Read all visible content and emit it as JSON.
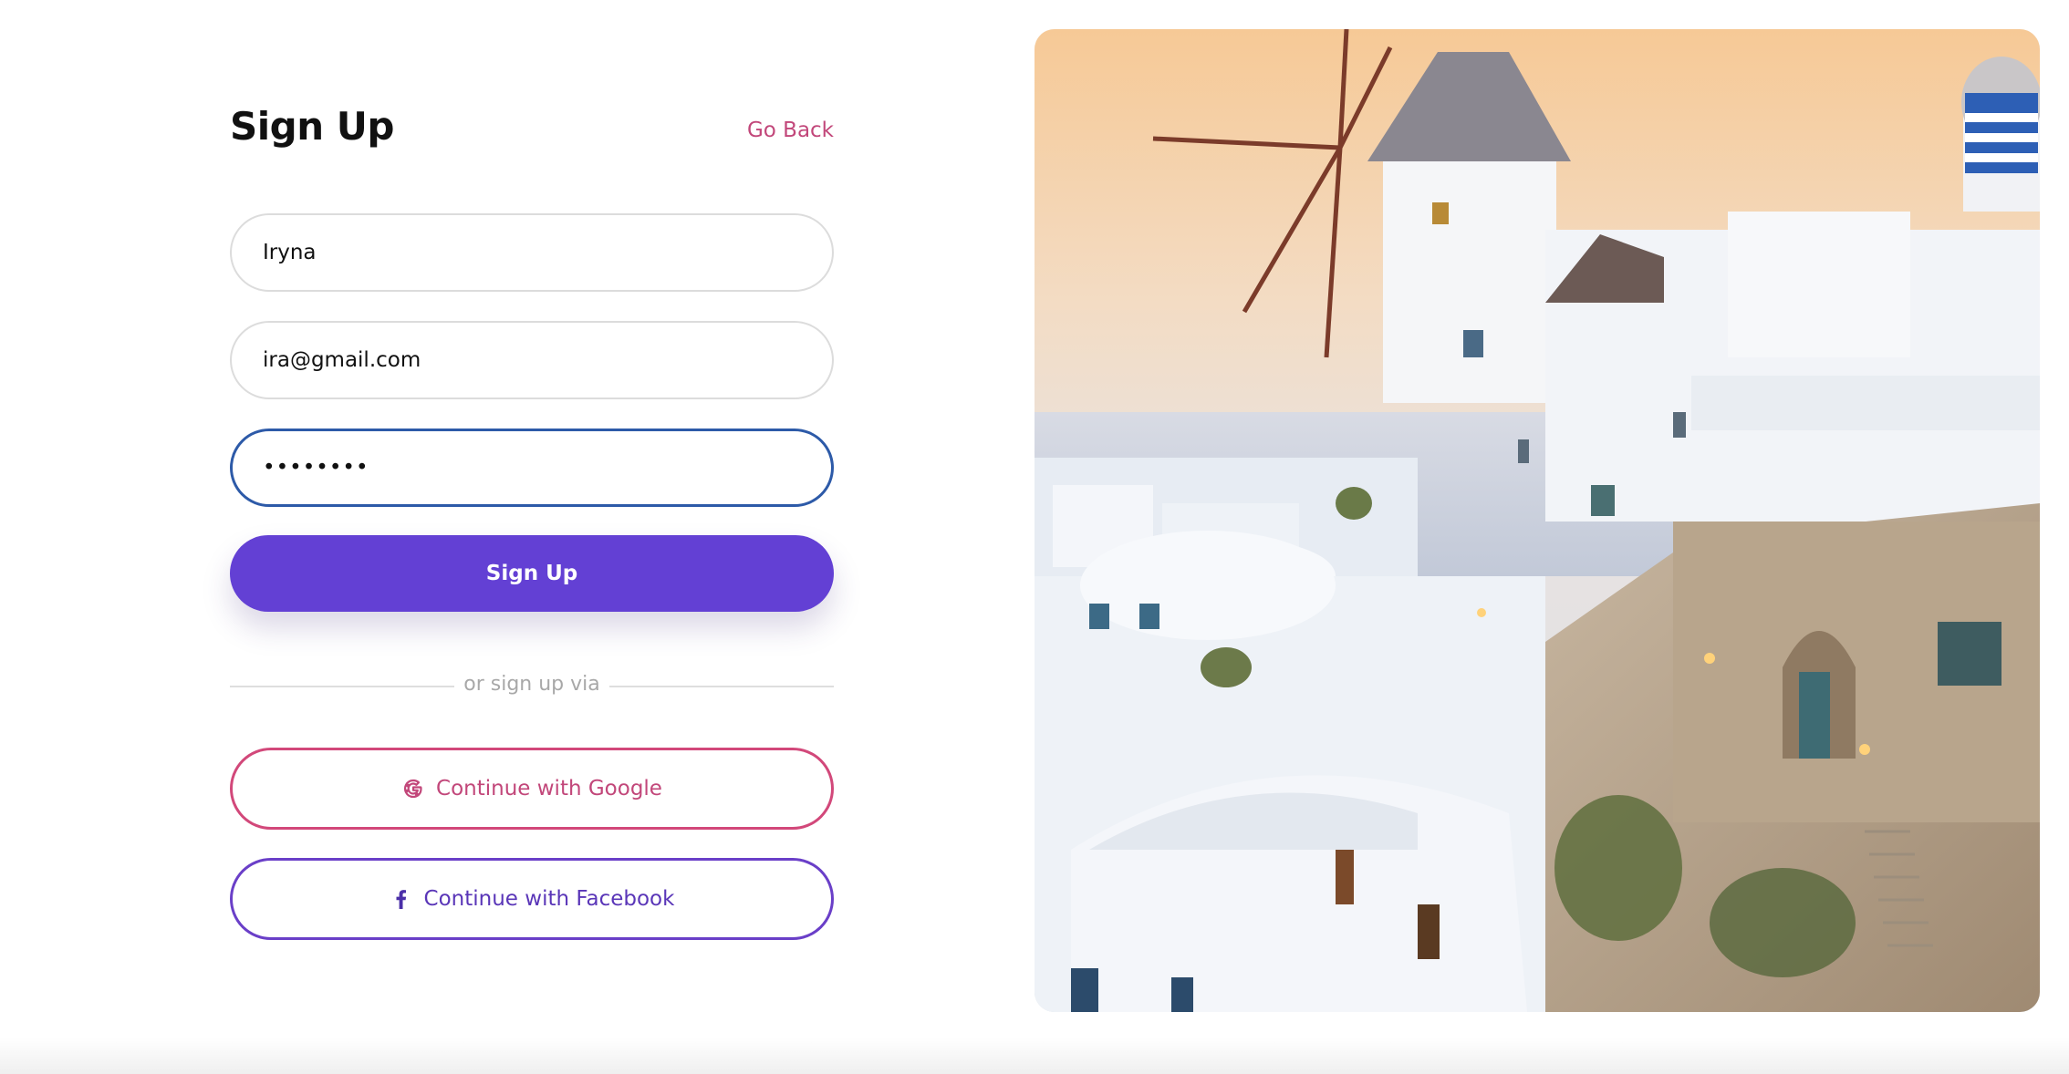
{
  "header": {
    "title": "Sign Up",
    "go_back_label": "Go Back"
  },
  "form": {
    "name_value": "Iryna",
    "email_value": "ira@gmail.com",
    "password_value": "••••••••",
    "submit_label": "Sign Up"
  },
  "divider": {
    "text": "or sign up via"
  },
  "social": {
    "google_label": "Continue with Google",
    "google_icon": "google-icon",
    "facebook_label": "Continue with Facebook",
    "facebook_icon": "facebook-icon"
  },
  "hero_image": {
    "subject": "santorini-village-photo"
  },
  "colors": {
    "accent": "#6340d4",
    "link": "#c2477a",
    "google_border": "#d2487a",
    "facebook_border": "#6a3fc8",
    "focus_border": "#2d5aa8"
  }
}
